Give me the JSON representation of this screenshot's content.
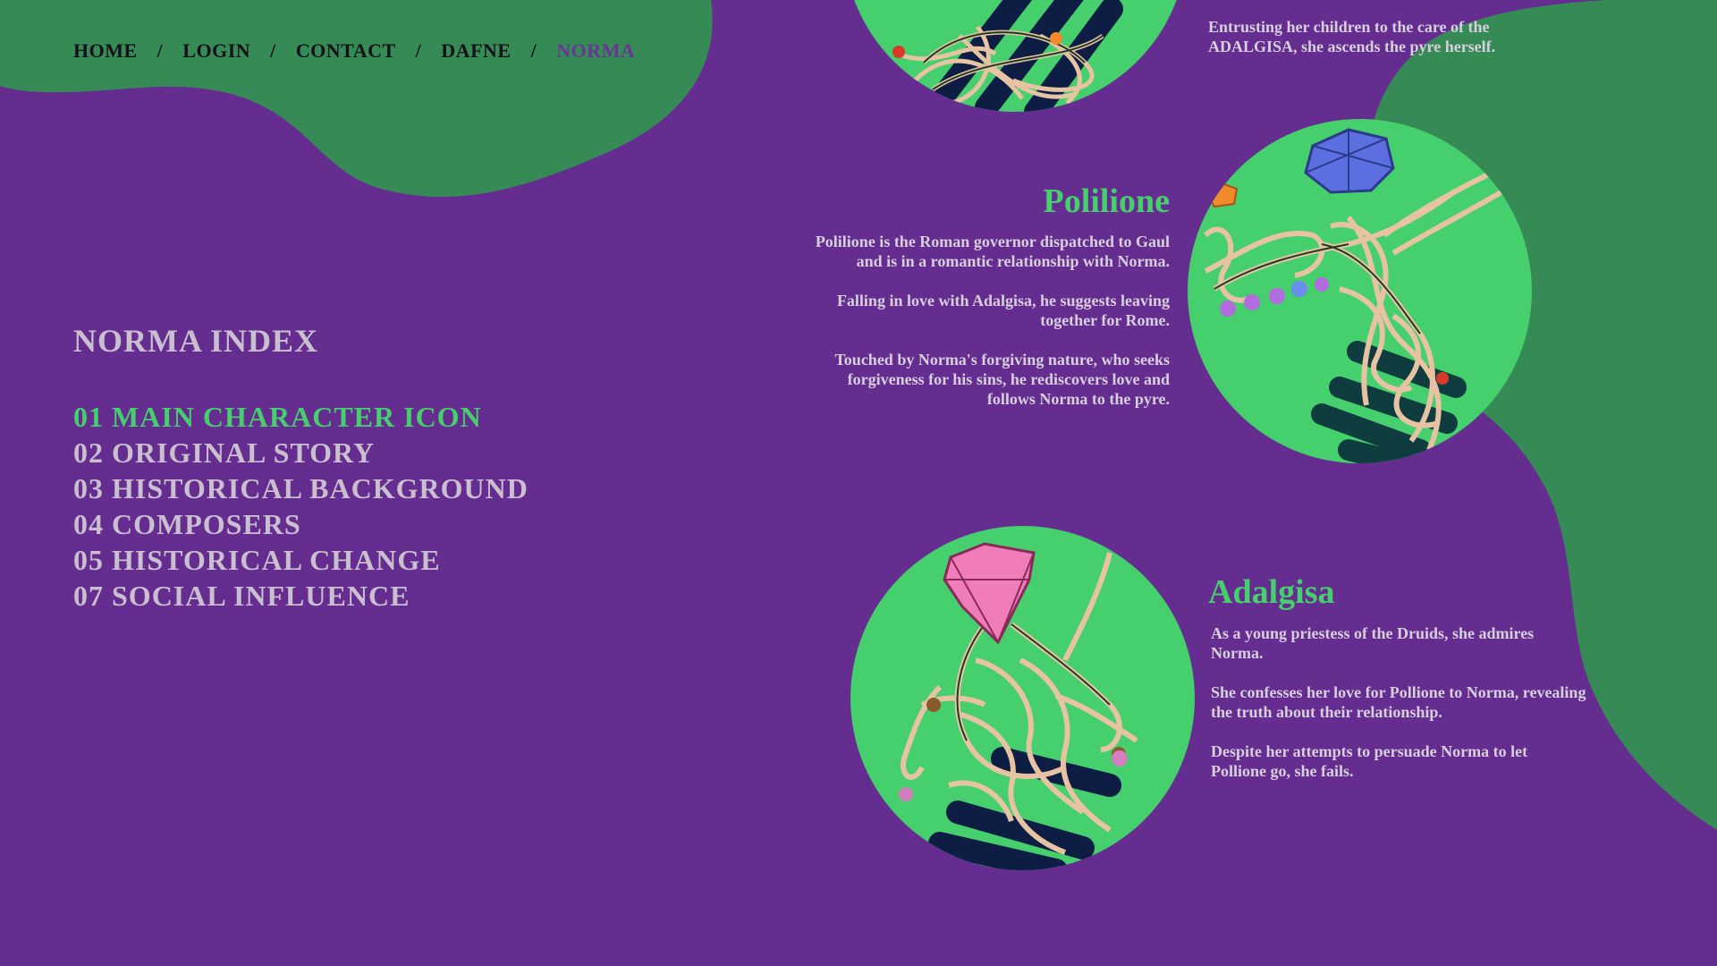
{
  "nav": {
    "items": [
      {
        "label": "HOME"
      },
      {
        "label": "LOGIN"
      },
      {
        "label": "CONTACT"
      },
      {
        "label": "DAFNE"
      },
      {
        "label": "NORMA"
      }
    ],
    "separator": "/"
  },
  "index": {
    "title": "NORMA INDEX",
    "items": [
      {
        "label": "01 MAIN CHARACTER ICON",
        "active": true
      },
      {
        "label": "02 ORIGINAL STORY"
      },
      {
        "label": "03 HISTORICAL BACKGROUND"
      },
      {
        "label": "04 COMPOSERS"
      },
      {
        "label": "05 HISTORICAL CHANGE"
      },
      {
        "label": "07 SOCIAL INFLUENCE"
      }
    ]
  },
  "characters": {
    "norma": {
      "paragraphs": [
        "Entrusting her children to the care of the ADALGISA, she ascends the pyre herself."
      ]
    },
    "polilione": {
      "name": "Polilione",
      "paragraphs": [
        "Polilione is the Roman governor dispatched to Gaul and is in a romantic relationship with Norma.",
        "Falling in love with Adalgisa, he suggests leaving together for Rome.",
        "Touched by Norma's forgiving nature, who seeks forgiveness for his sins, he rediscovers love and follows Norma to the pyre."
      ]
    },
    "adalgisa": {
      "name": "Adalgisa",
      "paragraphs": [
        "As a young priestess of the Druids, she admires Norma.",
        "She confesses her love for Pollione to Norma, revealing the truth about their relationship.",
        "Despite her attempts to persuade Norma to let Pollione go, she fails."
      ]
    }
  },
  "colors": {
    "background": "#642d8f",
    "blob": "#368a55",
    "accent_green": "#45cf6d",
    "nav_text": "#15101a",
    "nav_active": "#6a3596",
    "index_text": "#c9bfcf",
    "body_text": "#d7cfdd",
    "figure_rope": "#e7c3a4",
    "figure_dark": "#0e1d44",
    "gem_blue": "#5b6fe0",
    "gem_pink": "#f07cb8",
    "gem_orange": "#f08a2a"
  }
}
